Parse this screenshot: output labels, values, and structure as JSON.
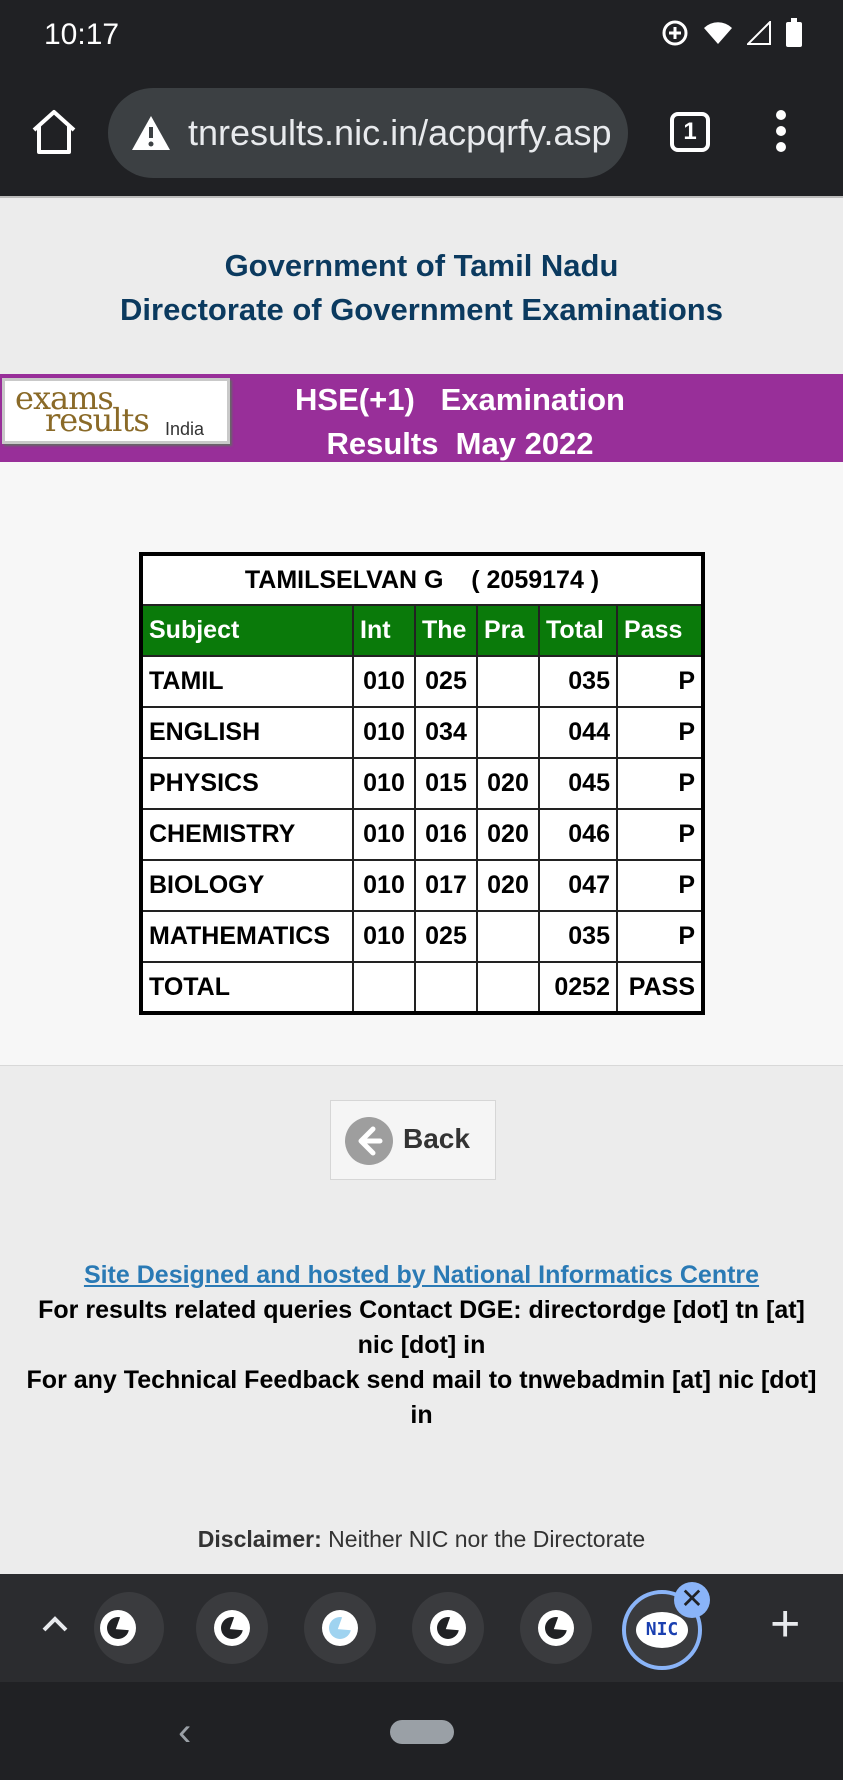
{
  "status_bar": {
    "time": "10:17"
  },
  "browser": {
    "url": "tnresults.nic.in/acpqrfy.asp",
    "tab_count": "1"
  },
  "page": {
    "gov_line1": "Government of Tamil Nadu",
    "gov_line2": "Directorate of Government Examinations",
    "logo": {
      "exams": "exams",
      "results": "results",
      "india": "India"
    },
    "exam_title_line1": "HSE(+1)   Examination",
    "exam_title_line2": "Results  May 2022",
    "student": {
      "name_line": "TAMILSELVAN G    ( 2059174 )"
    },
    "table_headers": [
      "Subject",
      "Int",
      "The",
      "Pra",
      "Total",
      "Pass"
    ],
    "rows": [
      {
        "subject": "TAMIL",
        "int": "010",
        "the": "025",
        "pra": "",
        "total": "035",
        "pass": "P"
      },
      {
        "subject": "ENGLISH",
        "int": "010",
        "the": "034",
        "pra": "",
        "total": "044",
        "pass": "P"
      },
      {
        "subject": "PHYSICS",
        "int": "010",
        "the": "015",
        "pra": "020",
        "total": "045",
        "pass": "P"
      },
      {
        "subject": "CHEMISTRY",
        "int": "010",
        "the": "016",
        "pra": "020",
        "total": "046",
        "pass": "P"
      },
      {
        "subject": "BIOLOGY",
        "int": "010",
        "the": "017",
        "pra": "020",
        "total": "047",
        "pass": "P"
      },
      {
        "subject": "MATHEMATICS",
        "int": "010",
        "the": "025",
        "pra": "",
        "total": "035",
        "pass": "P"
      },
      {
        "subject": "TOTAL",
        "int": "",
        "the": "",
        "pra": "",
        "total": "0252",
        "pass": "PASS"
      }
    ],
    "back_label": "Back",
    "footer": {
      "link": "Site Designed and hosted by National Informatics Centre",
      "contact": "For results related queries Contact DGE:  directordge [dot] tn [at] nic [dot] in",
      "feedback": "For any Technical Feedback send mail to tnwebadmin [at] nic [dot] in"
    },
    "disclaimer_label": "Disclaimer:",
    "disclaimer_text": " Neither NIC nor the Directorate"
  },
  "tab_strip": {
    "active_tab_label": "NIC",
    "close_symbol": "✕",
    "plus_symbol": "+"
  },
  "icons": {
    "home": "home-icon",
    "warning": "warning-icon",
    "menu": "more-vert-icon",
    "back": "arrow-left-icon",
    "up": "chevron-up-icon",
    "globe": "globe-icon"
  },
  "colors": {
    "banner": "#982f99",
    "header_green": "#0a7a0a",
    "title_blue": "#0b3a5f",
    "link_blue": "#2a7ab5"
  }
}
